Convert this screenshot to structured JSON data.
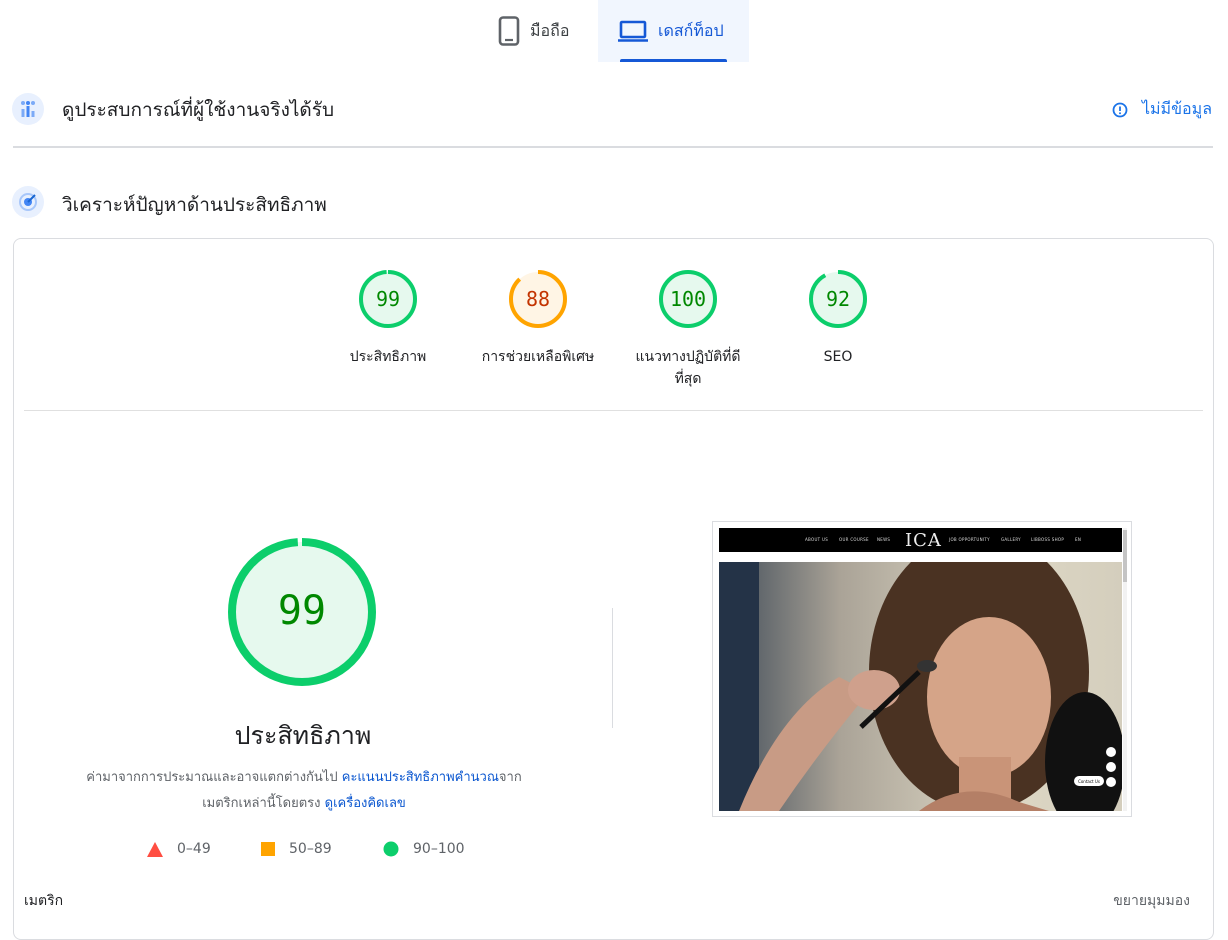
{
  "tabs": {
    "mobile_label": "มือถือ",
    "desktop_label": "เดสก์ท็อป"
  },
  "field_data": {
    "title": "ดูประสบการณ์ที่ผู้ใช้งานจริงได้รับ",
    "status": "ไม่มีข้อมูล"
  },
  "diagnose": {
    "title": "วิเคราะห์ปัญหาด้านประสิทธิภาพ"
  },
  "gauges": [
    {
      "score": "99",
      "label": "ประสิทธิภาพ",
      "label2": "",
      "value": 99,
      "status": "pass",
      "color": "#0cce6b",
      "text_color": "#008800"
    },
    {
      "score": "88",
      "label": "การช่วยเหลือพิเศษ",
      "label2": "",
      "value": 88,
      "status": "average",
      "color": "#ffa400",
      "text_color": "#c33300"
    },
    {
      "score": "100",
      "label": "แนวทางปฏิบัติที่ดี",
      "label2": "ที่สุด",
      "value": 100,
      "status": "pass",
      "color": "#0cce6b",
      "text_color": "#008800"
    },
    {
      "score": "92",
      "label": "SEO",
      "label2": "",
      "value": 92,
      "status": "pass",
      "color": "#0cce6b",
      "text_color": "#008800"
    }
  ],
  "performance": {
    "score": "99",
    "value": 99,
    "title": "ประสิทธิภาพ",
    "desc_1": "ค่ามาจากการประมาณและอาจแตกต่างกันไป",
    "link_1": "คะแนนประสิทธิภาพคำนวณ",
    "desc_2": "จาก",
    "desc_3": "เมตริกเหล่านี้โดยตรง",
    "link_2": "ดูเครื่องคิดเลข"
  },
  "legend": {
    "fail": "0–49",
    "average": "50–89",
    "pass": "90–100"
  },
  "colors": {
    "pass": "#0cce6b",
    "average": "#ffa400",
    "fail": "#ff4e42",
    "link": "#0b57d0"
  },
  "thumbnail": {
    "nav": [
      "ABOUT US",
      "OUR COURSE",
      "NEWS",
      "JOB OPPORTUNITY",
      "GALLERY",
      "LIBBOSS SHOP",
      "EN"
    ],
    "logo": "ICA",
    "contact": "Contact Us"
  },
  "metrics": {
    "label": "เมตริก",
    "expand": "ขยายมุมมอง"
  }
}
